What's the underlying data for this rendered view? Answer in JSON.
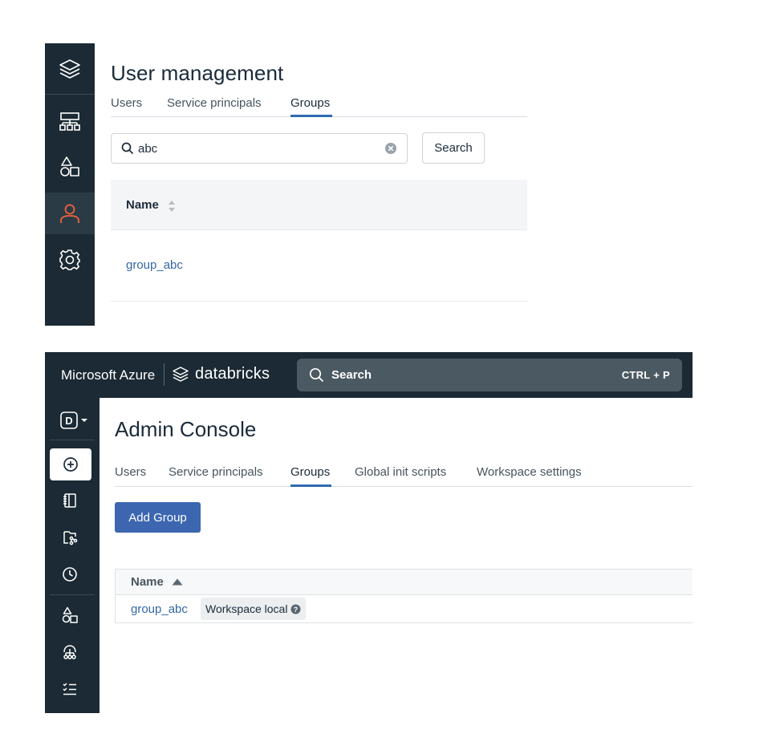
{
  "user_management": {
    "title": "User management",
    "tabs": [
      {
        "label": "Users",
        "active": false
      },
      {
        "label": "Service principals",
        "active": false
      },
      {
        "label": "Groups",
        "active": true
      }
    ],
    "search": {
      "value": "abc",
      "button_label": "Search"
    },
    "table": {
      "header": "Name",
      "rows": [
        {
          "name": "group_abc"
        }
      ]
    },
    "sidebar": {
      "icons": [
        "layers-icon",
        "hierarchy-icon",
        "shapes-icon",
        "user-icon",
        "gear-icon"
      ],
      "active": "user-icon"
    }
  },
  "admin_console": {
    "topbar": {
      "microsoft_label": "Microsoft Azure",
      "brand_label": "databricks",
      "search_label": "Search",
      "shortcut": "CTRL + P"
    },
    "workspace_initial": "D",
    "title": "Admin Console",
    "tabs": [
      {
        "label": "Users",
        "active": false
      },
      {
        "label": "Service principals",
        "active": false
      },
      {
        "label": "Groups",
        "active": true
      },
      {
        "label": "Global init scripts",
        "active": false
      },
      {
        "label": "Workspace settings",
        "active": false
      }
    ],
    "add_button_label": "Add Group",
    "table": {
      "header": "Name",
      "rows": [
        {
          "name": "group_abc",
          "badge": "Workspace local"
        }
      ]
    }
  },
  "colors": {
    "sidebar_bg": "#1b2a34",
    "accent_blue": "#2f6ab2",
    "link_blue": "#3567a6",
    "primary_button": "#3c66b0",
    "active_icon": "#f0633c"
  }
}
